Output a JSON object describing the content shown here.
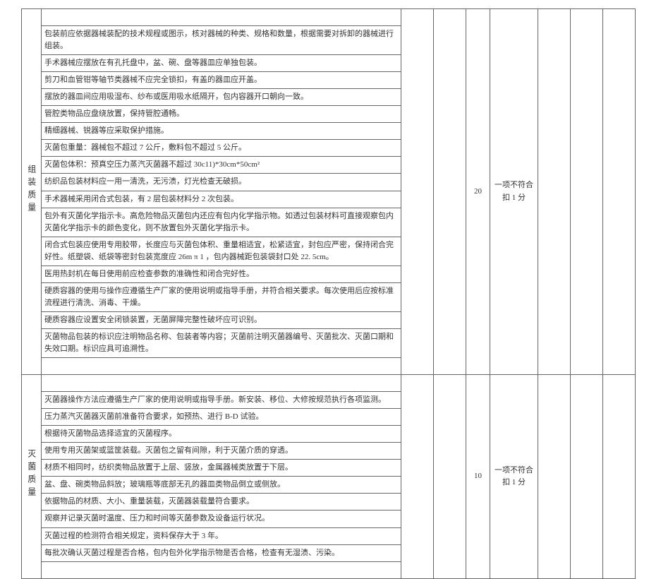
{
  "sections": [
    {
      "label": "组装质量",
      "score": "20",
      "rule": "一项不符合扣 1 分",
      "rows": [
        "包装前应依据器械装配的技术规程或图示，核对器械的种类、规格和数量，根据需要对拆卸的器械进行组装。",
        "手术器械应摆放在有孔托盘中，盆、碗、盘等器皿应单独包装。",
        "剪刀和血管钳等轴节类器械不应完全锁扣，有盖的器皿应开盖。",
        "摆放的器皿间应用吸湿布、纱布或医用吸水纸隔开，包内容器开口朝向一致。",
        "管腔类物品应盘绕放置，保持管腔通畅。",
        "精细器械、锐器等应采取保护措施。",
        "灭菌包重量：器械包不超过 7 公斤，敷料包不超过 5 公斤。",
        "灭菌包体积：预真空压力蒸汽灭菌器不超过 30c11)*30cm*50cm²",
        "纺织品包装材料应一用一清洗，无污渍，灯光检查无破损。",
        "手术器械采用闭合式包装，有 2 层包装材料分 2 次包装。",
        "包外有灭菌化学指示卡。高危险物品灭菌包内还应有包内化学指示物。如透过包装材料可直接观察包内灭菌化学指示卡的颜色变化，则不放置包外灭菌化学指示卡。",
        "闭合式包装应使用专用胶带，长度应与灭菌包体积、重量相适宜，松紧适宜，封包应严密，保持闭合完好性。纸塑袋、纸袋等密封包装宽度应 26m π 1 ，包内器械距包装袋封口处 22. 5cm。",
        "医用热封机在每日使用前应检查参数的准确性和闭合完好性。",
        "硬质容器的使用与操作应遵循生产厂家的使用说明或指导手册，并符合相关要求。每次使用后应按标准流程进行清洗、消毒、干燥。",
        "硬质容器应设置安全闭锁装置，无菌屏障完整性破坏应可识别。",
        "灭菌物品包装的标识应注明物品名称、包装者等内容；灭菌前注明灭菌器编号、灭菌批次、灭菌口期和失效口期。标识应具可追溯性。"
      ]
    },
    {
      "label": "灭菌质量",
      "score": "10",
      "rule": "一项不符合扣 1 分",
      "rows": [
        "灭菌器操作方法应遵循生产厂家的使用说明或指导手册。新安装、移位、大修按规范执行各项监测。",
        "压力蒸汽灭菌器灭菌前准备符合要求，如预热、进行 B-D 试验。",
        "根据待灭菌物品选择适宜的灭菌程序。",
        "使用专用灭菌架或篮筐装载。灭菌包之留有间隙，利于灭菌介质的穿透。",
        "材质不相同时，纺织类物品放置于上层、竖放，金属器械类放置于下层。",
        "盆、盘、碗类物品斜放；玻璃瓶等底部无孔的器皿类物品倒立或侧放。",
        "依据物品的材质、大小、重量装载，灭菌器装载量符合要求。",
        "观察并记录灭菌时温度、压力和时间等灭菌参数及设备运行状况。",
        "灭菌过程的检测符合相关规定，资料保存大于 3 年。",
        "每批次确认灭菌过程是否合格，包内包外化学指示物是否合格，检查有无湿渍、污染。"
      ]
    }
  ]
}
